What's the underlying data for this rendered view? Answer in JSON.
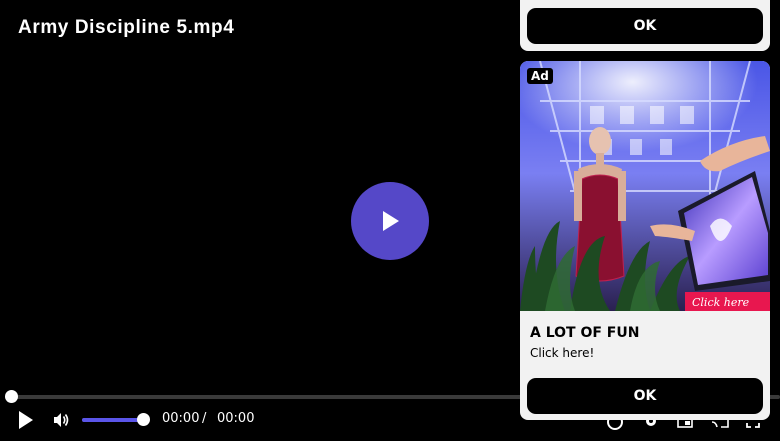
{
  "player": {
    "title": "Army Discipline 5.mp4",
    "current_time": "00:00",
    "separator": "/",
    "duration": "00:00",
    "progress": 0,
    "volume": 1.0,
    "accent_color": "#5548c8"
  },
  "ad": {
    "badge": "Ad",
    "headline": "A LOT OF FUN",
    "subtext": "Click here!",
    "ok_top_label": "OK",
    "ok_bottom_label": "OK",
    "image_cta_text": "Click here"
  },
  "icons": {
    "big_play": "play-icon",
    "play": "play-icon",
    "volume": "volume-icon",
    "chromecast": "cast-icon",
    "settings": "gear-icon",
    "pip": "picture-in-picture-icon",
    "fullscreen": "fullscreen-icon"
  }
}
